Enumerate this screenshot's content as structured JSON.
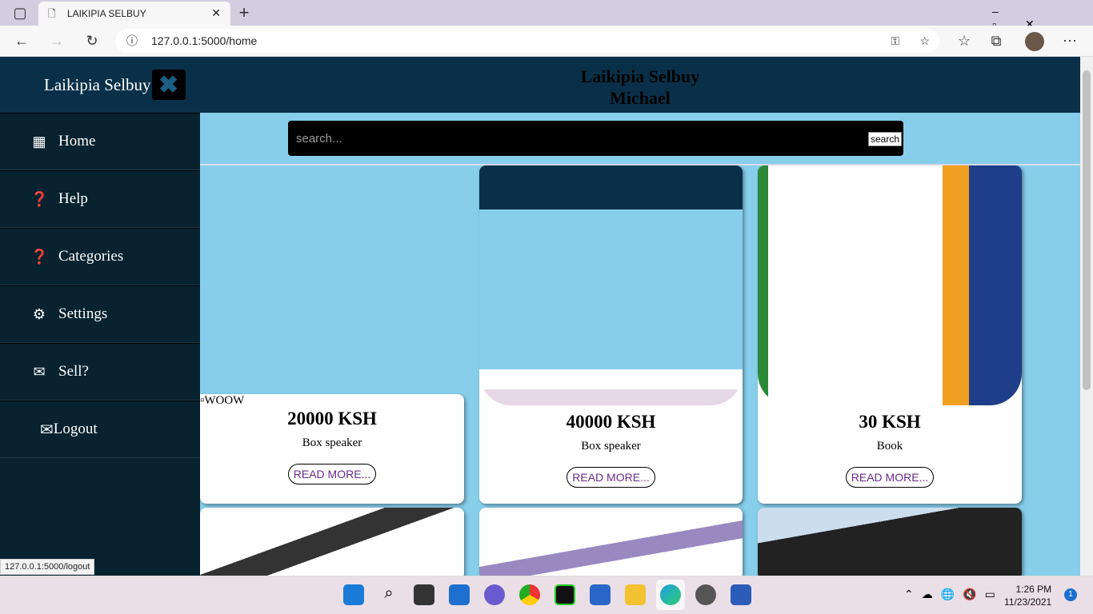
{
  "browser": {
    "tab_title": "LAIKIPIA SELBUY",
    "url": "127.0.0.1:5000/home",
    "status_url": "127.0.0.1:5000/logout"
  },
  "header": {
    "title": "Laikipia Selbuy",
    "user": "Michael"
  },
  "sidebar": {
    "brand": "Laikipia Selbuy",
    "items": [
      {
        "label": "Home",
        "icon": "qr-icon"
      },
      {
        "label": "Help",
        "icon": "question-icon"
      },
      {
        "label": "Categories",
        "icon": "question-icon"
      },
      {
        "label": "Settings",
        "icon": "gear-icon"
      },
      {
        "label": "Sell?",
        "icon": "envelope-icon"
      },
      {
        "label": "Logout",
        "icon": "envelope-icon"
      }
    ]
  },
  "search": {
    "placeholder": "search...",
    "button": "search"
  },
  "products": [
    {
      "price": "20000 KSH",
      "name": "Box speaker",
      "button": "READ MORE...",
      "image_alt": "WOOW"
    },
    {
      "price": "40000 KSH",
      "name": "Box speaker",
      "button": "READ MORE..."
    },
    {
      "price": "30 KSH",
      "name": "Book",
      "button": "READ MORE..."
    }
  ],
  "taskbar": {
    "time": "1:26 PM",
    "date": "11/23/2021",
    "notifications": "1"
  }
}
